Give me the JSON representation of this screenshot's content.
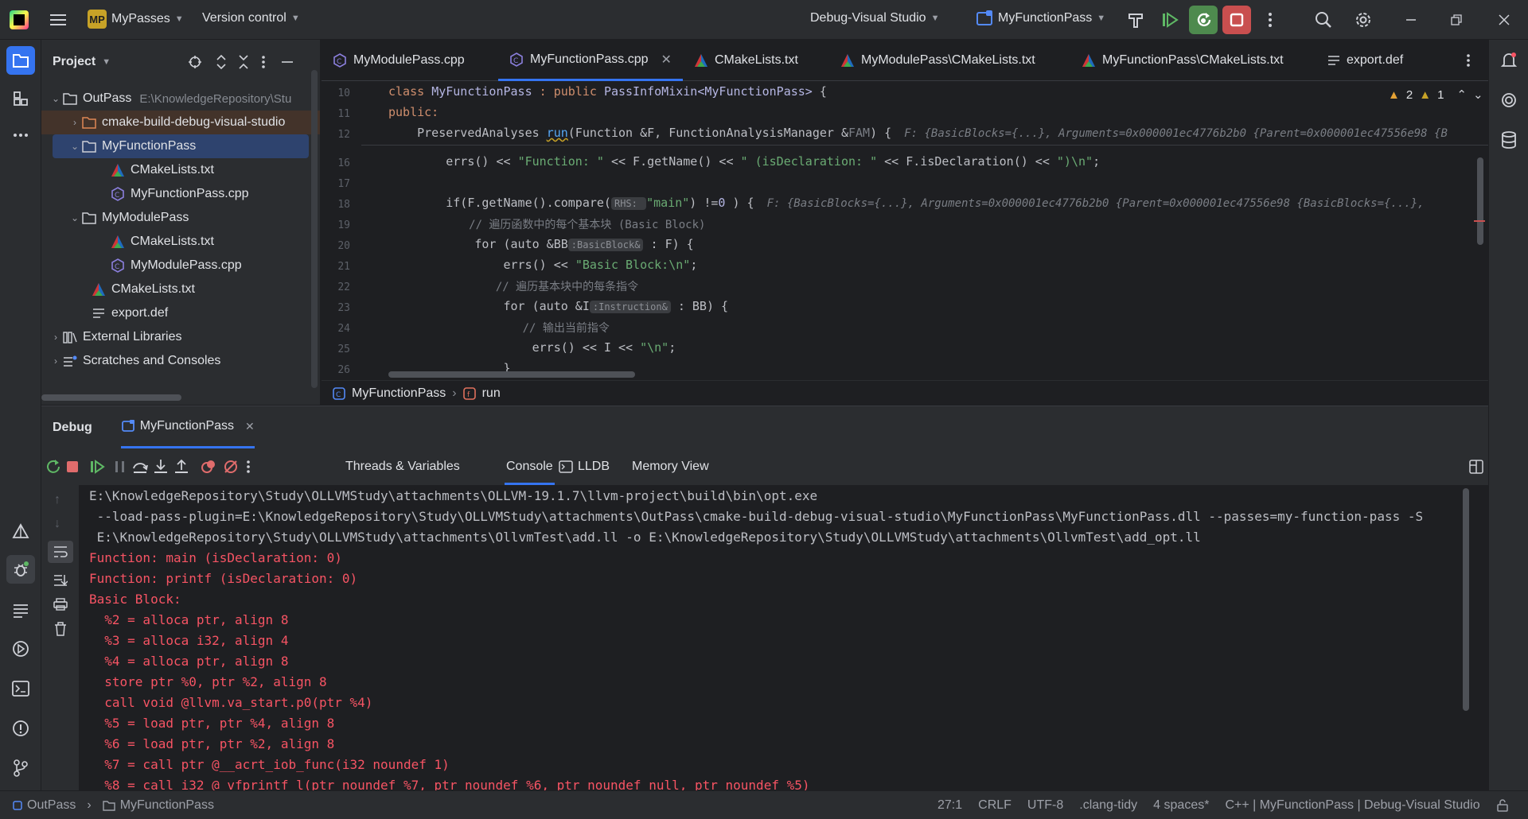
{
  "titlebar": {
    "project_badge": "MP",
    "project_name": "MyPasses",
    "vcs": "Version control",
    "build_config": "Debug-Visual Studio",
    "run_config": "MyFunctionPass",
    "accent_green": "#4e8a4e",
    "accent_red": "#c94f4f"
  },
  "project": {
    "title": "Project",
    "tree": [
      {
        "label": "OutPass",
        "hint": "E:\\KnowledgeRepository\\Stu",
        "icon": "folder-icon",
        "arrow": "expanded"
      },
      {
        "label": "cmake-build-debug-visual-studio",
        "icon": "folder-orange-icon",
        "arrow": "collapsed"
      },
      {
        "label": "MyFunctionPass",
        "icon": "folder-icon",
        "arrow": "expanded"
      },
      {
        "label": "CMakeLists.txt",
        "icon": "cmake-icon"
      },
      {
        "label": "MyFunctionPass.cpp",
        "icon": "cpp-icon"
      },
      {
        "label": "MyModulePass",
        "icon": "folder-icon",
        "arrow": "expanded"
      },
      {
        "label": "CMakeLists.txt",
        "icon": "cmake-icon"
      },
      {
        "label": "MyModulePass.cpp",
        "icon": "cpp-icon"
      },
      {
        "label": "CMakeLists.txt",
        "icon": "cmake-icon"
      },
      {
        "label": "export.def",
        "icon": "text-file-icon"
      },
      {
        "label": "External Libraries",
        "icon": "library-icon",
        "arrow": "collapsed"
      },
      {
        "label": "Scratches and Consoles",
        "icon": "scratches-icon",
        "arrow": "collapsed"
      }
    ]
  },
  "editor": {
    "tabs": [
      {
        "label": "MyModulePass.cpp"
      },
      {
        "label": "MyFunctionPass.cpp"
      },
      {
        "label": "CMakeLists.txt"
      },
      {
        "label": "MyModulePass\\CMakeLists.txt"
      },
      {
        "label": "MyFunctionPass\\CMakeLists.txt"
      },
      {
        "label": "export.def"
      }
    ],
    "warnings": "2",
    "weak_warnings": "1",
    "line_numbers": [
      "10",
      "11",
      "12",
      "16",
      "17",
      "18",
      "19",
      "20",
      "21",
      "22",
      "23",
      "24",
      "25",
      "26"
    ],
    "lines": {
      "l10_a": "class ",
      "l10_b": "MyFunctionPass",
      "l10_c": " : public ",
      "l10_d": "PassInfoMixin<MyFunctionPass>",
      "l10_e": " {",
      "l11": "public:",
      "l12_a": "    PreservedAnalyses ",
      "l12_b": "run",
      "l12_c": "(Function &F, FunctionAnalysisManager &",
      "l12_d": "FAM",
      "l12_e": ") {",
      "l12_hint": "F: {BasicBlocks={...}, Arguments=0x000001ec4776b2b0 {Parent=0x000001ec47556e98 {B",
      "l16_a": "        errs() << ",
      "l16_b": "\"Function: \"",
      "l16_c": " << F.getName() << ",
      "l16_d": "\" (isDeclaration: \"",
      "l16_e": " << F.isDeclaration() << ",
      "l16_f": "\")\\n\"",
      "l16_g": ";",
      "l18_a": "        if(F.getName().compare(",
      "l18_inlay": "RHS: ",
      "l18_b": "\"main\"",
      "l18_c": ") !=",
      "l18_d": "0",
      "l18_e": " ) {",
      "l18_hint": "F: {BasicBlocks={...}, Arguments=0x000001ec4776b2b0 {Parent=0x000001ec47556e98 {BasicBlocks={...},",
      "l19": "            // 遍历函数中的每个基本块 (Basic Block)",
      "l20_a": "            for (auto &BB",
      "l20_inlay": ":BasicBlock&",
      "l20_b": " : F) {",
      "l21_a": "                errs() << ",
      "l21_b": "\"Basic Block:\\n\"",
      "l21_c": ";",
      "l22": "                // 遍历基本块中的每条指令",
      "l23_a": "                for (auto &I",
      "l23_inlay": ":Instruction&",
      "l23_b": " : BB) {",
      "l24": "                    // 输出当前指令",
      "l25_a": "                    errs() << I << ",
      "l25_b": "\"\\n\"",
      "l25_c": ";",
      "l26": "                }"
    },
    "breadcrumb": {
      "class": "MyFunctionPass",
      "method": "run"
    }
  },
  "debug": {
    "title": "Debug",
    "session_tab": "MyFunctionPass",
    "tabs": [
      "Threads & Variables",
      "Console",
      "LLDB",
      "Memory View"
    ],
    "console_lines": [
      {
        "text": "E:\\KnowledgeRepository\\Study\\OLLVMStudy\\attachments\\OLLVM-19.1.7\\llvm-project\\build\\bin\\opt.exe",
        "kind": "cmd"
      },
      {
        "text": " --load-pass-plugin=E:\\KnowledgeRepository\\Study\\OLLVMStudy\\attachments\\OutPass\\cmake-build-debug-visual-studio\\MyFunctionPass\\MyFunctionPass.dll --passes=my-function-pass -S",
        "kind": "cmd"
      },
      {
        "text": " E:\\KnowledgeRepository\\Study\\OLLVMStudy\\attachments\\OllvmTest\\add.ll -o E:\\KnowledgeRepository\\Study\\OLLVMStudy\\attachments\\OllvmTest\\add_opt.ll",
        "kind": "cmd"
      },
      {
        "text": "Function: main (isDeclaration: 0)",
        "kind": "err"
      },
      {
        "text": "Function: printf (isDeclaration: 0)",
        "kind": "err"
      },
      {
        "text": "Basic Block:",
        "kind": "err"
      },
      {
        "text": "  %2 = alloca ptr, align 8",
        "kind": "err"
      },
      {
        "text": "  %3 = alloca i32, align 4",
        "kind": "err"
      },
      {
        "text": "  %4 = alloca ptr, align 8",
        "kind": "err"
      },
      {
        "text": "  store ptr %0, ptr %2, align 8",
        "kind": "err"
      },
      {
        "text": "  call void @llvm.va_start.p0(ptr %4)",
        "kind": "err"
      },
      {
        "text": "  %5 = load ptr, ptr %4, align 8",
        "kind": "err"
      },
      {
        "text": "  %6 = load ptr, ptr %2, align 8",
        "kind": "err"
      },
      {
        "text": "  %7 = call ptr @__acrt_iob_func(i32 noundef 1)",
        "kind": "err"
      },
      {
        "text": "  %8 = call i32 @_vfprintf_l(ptr noundef %7, ptr noundef %6, ptr noundef null, ptr noundef %5)",
        "kind": "err"
      }
    ],
    "colors": {
      "cmd": "#bcbec4",
      "err": "#f75464"
    }
  },
  "statusbar": {
    "breadcrumb_root": "OutPass",
    "breadcrumb_child": "MyFunctionPass",
    "position": "27:1",
    "line_sep": "CRLF",
    "encoding": "UTF-8",
    "linter": ".clang-tidy",
    "indent": "4 spaces*",
    "context": "C++ | MyFunctionPass | Debug-Visual Studio"
  }
}
